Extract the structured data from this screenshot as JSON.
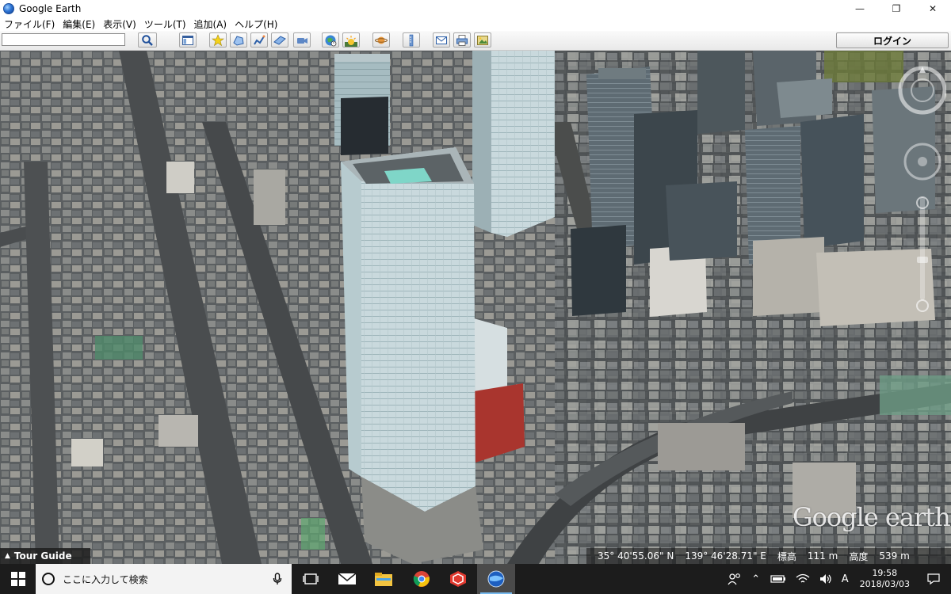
{
  "window": {
    "title": "Google Earth",
    "controls": [
      "—",
      "❐",
      "✕"
    ]
  },
  "menu": [
    "ファイル(F)",
    "編集(E)",
    "表示(V)",
    "ツール(T)",
    "追加(A)",
    "ヘルプ(H)"
  ],
  "toolbar": {
    "search_value": "",
    "login_label": "ログイン",
    "icons": [
      "search-icon",
      "sidebar-icon",
      "add-placemark-icon",
      "add-polygon-icon",
      "add-path-icon",
      "add-image-overlay-icon",
      "record-tour-icon",
      "historical-imagery-icon",
      "sun-icon",
      "planets-icon",
      "ruler-icon",
      "email-icon",
      "print-icon",
      "save-image-icon"
    ]
  },
  "map": {
    "tour_guide_label": "Tour Guide",
    "watermark": "Google earth",
    "status": {
      "latitude": "35° 40'55.06\" N",
      "longitude": "139° 46'28.71\" E",
      "elevation_label": "標高",
      "elevation_value": "111 m",
      "eye_alt_label": "高度",
      "eye_alt_value": "539 m"
    }
  },
  "taskbar": {
    "search_placeholder": "ここに入力して検索",
    "apps": [
      "task-view-icon",
      "mail-icon",
      "file-explorer-icon",
      "chrome-icon",
      "sketchup-icon",
      "google-earth-icon"
    ],
    "ime_label": "A",
    "time": "19:58",
    "date": "2018/03/03"
  },
  "colors": {
    "taskbar_bg": "#1c1c1c",
    "accent": "#76b9ed",
    "tower": "#c8d8dc"
  }
}
